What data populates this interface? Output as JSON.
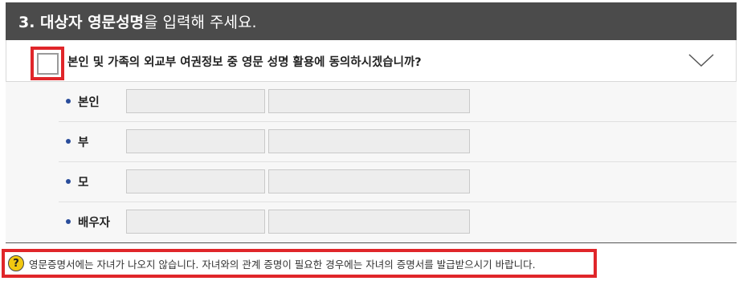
{
  "section": {
    "title_bold": "3. 대상자 영문성명",
    "title_normal": "을 입력해 주세요."
  },
  "consent": {
    "text": "본인 및 가족의 외교부 여권정보 중 영문 성명 활용에 동의하시겠습니까?",
    "checked": false,
    "expand_icon": "chevron-down-icon"
  },
  "rows": [
    {
      "label": "본인",
      "field1": "",
      "field2": ""
    },
    {
      "label": "부",
      "field1": "",
      "field2": ""
    },
    {
      "label": "모",
      "field1": "",
      "field2": ""
    },
    {
      "label": "배우자",
      "field1": "",
      "field2": ""
    }
  ],
  "notice": {
    "icon": "question-icon",
    "icon_glyph": "?",
    "text": "영문증명서에는 자녀가 나오지 않습니다. 자녀와의 관계 증명이 필요한 경우에는 자녀의 증명서를 발급받으시기 바랍니다."
  },
  "colors": {
    "header_bg": "#4b4b4b",
    "highlight": "#e0262a",
    "bullet": "#2a4d9b",
    "help_icon": "#f2c811"
  }
}
